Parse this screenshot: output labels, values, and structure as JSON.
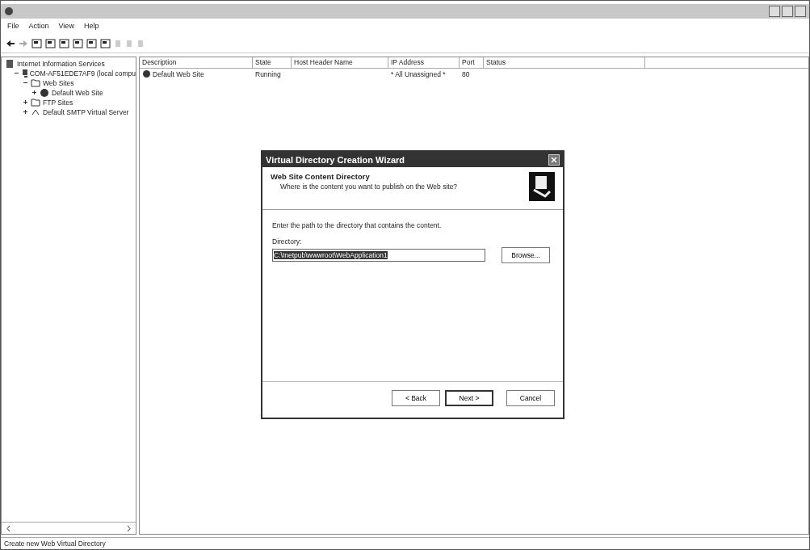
{
  "menu": [
    "File",
    "Action",
    "View",
    "Help"
  ],
  "tree": {
    "label": "Internet Information Services",
    "children": [
      {
        "label": "COM-AF51EDE7AF9 (local compu",
        "expanded": true,
        "kind": "computer",
        "children": [
          {
            "label": "Web Sites",
            "expanded": true,
            "kind": "folder",
            "children": [
              {
                "label": "Default Web Site",
                "expanded": false,
                "kind": "site"
              }
            ]
          },
          {
            "label": "FTP Sites",
            "expanded": false,
            "kind": "folder"
          },
          {
            "label": "Default SMTP Virtual Server",
            "expanded": false,
            "kind": "smtp"
          }
        ]
      }
    ]
  },
  "table": {
    "columns": [
      "Description",
      "State",
      "Host Header Name",
      "IP Address",
      "Port",
      "Status"
    ],
    "rows": [
      [
        "Default Web Site",
        "Running",
        "",
        "* All Unassigned *",
        "80",
        ""
      ]
    ]
  },
  "dialog": {
    "title": "Virtual Directory Creation Wizard",
    "heading": "Web Site Content Directory",
    "subheading": "Where is the content you want to publish on the Web site?",
    "instruction": "Enter the path to the directory that contains the content.",
    "field_label": "Directory:",
    "value": "C:\\Inetpub\\wwwroot\\WebApplication1",
    "browse": "Browse...",
    "buttons": [
      {
        "label": "< Back",
        "default": false
      },
      {
        "label": "Next >",
        "default": true
      },
      {
        "label": "Cancel",
        "default": false
      }
    ]
  },
  "status_bar": "Create new Web Virtual Directory"
}
